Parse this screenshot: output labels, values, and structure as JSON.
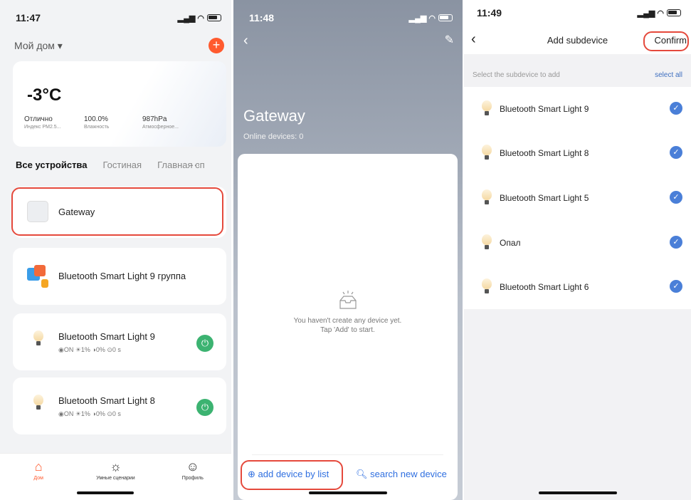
{
  "screen1": {
    "time": "11:47",
    "home_title": "Мой дом ▾",
    "plus": "+",
    "weather": {
      "temp": "-3°C",
      "stats": [
        {
          "value": "Отлично",
          "label": "Индекс PM2.5..."
        },
        {
          "value": "100.0%",
          "label": "Влажность"
        },
        {
          "value": "987hPa",
          "label": "Атмосферное..."
        }
      ]
    },
    "tabs": [
      "Все устройства",
      "Гостиная",
      "Главная сп"
    ],
    "more": "···",
    "devices": [
      {
        "name": "Gateway"
      },
      {
        "name": "Bluetooth Smart Light 9 группа"
      },
      {
        "name": "Bluetooth Smart Light 9",
        "status": "◉ON ☀1% ◑0% ⊙0 s"
      },
      {
        "name": "Bluetooth Smart Light 8",
        "status": "◉ON ☀1% ◑0% ⊙0 s"
      }
    ],
    "nav": [
      {
        "label": "Дом",
        "icon": "home-icon"
      },
      {
        "label": "Умные сценарии",
        "icon": "sun-icon"
      },
      {
        "label": "Профиль",
        "icon": "profile-icon"
      }
    ]
  },
  "screen2": {
    "time": "11:48",
    "title": "Gateway",
    "online": "Online devices: 0",
    "empty_line1": "You haven't create any device yet.",
    "empty_line2": "Tap 'Add' to start.",
    "add_by_list": "add device by list",
    "search_new": "search new device"
  },
  "screen3": {
    "time": "11:49",
    "title": "Add subdevice",
    "confirm": "Confirm",
    "select_hint": "Select the subdevice to add",
    "select_all": "select all",
    "items": [
      "Bluetooth Smart Light 9",
      "Bluetooth Smart Light 8",
      "Bluetooth Smart Light 5",
      "Опал",
      "Bluetooth Smart Light 6"
    ]
  },
  "colors": {
    "accent": "#ff5a2e",
    "highlight": "#e5493c",
    "link": "#2f6fe0",
    "check": "#4a7fd8",
    "power": "#3cb371"
  }
}
